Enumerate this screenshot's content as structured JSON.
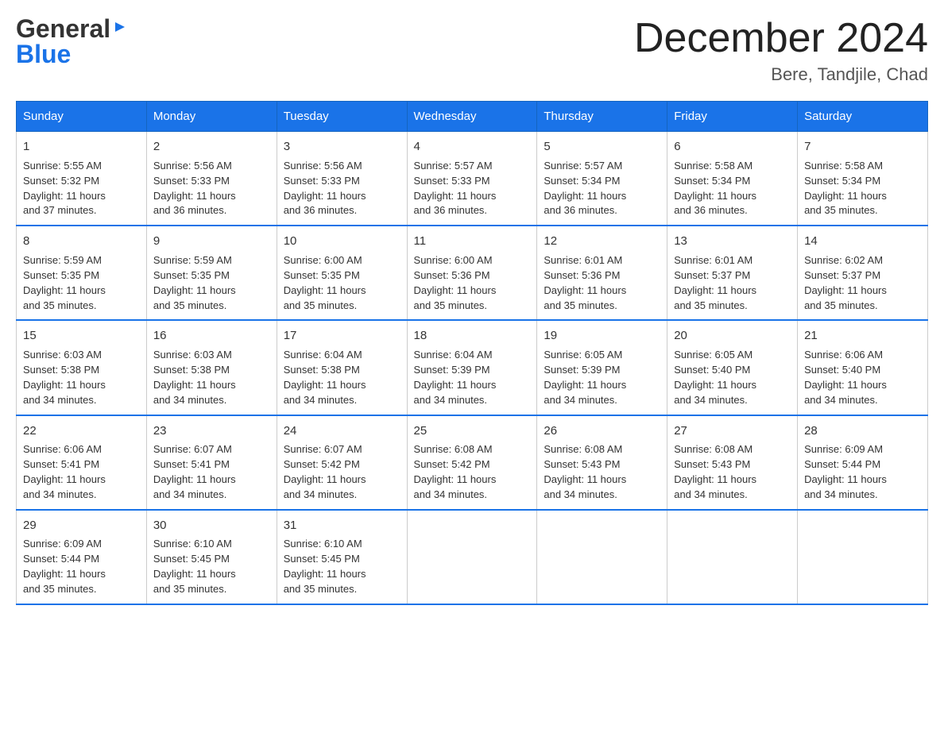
{
  "logo": {
    "line1": "General",
    "triangle": "▶",
    "line2": "Blue"
  },
  "title": {
    "month": "December 2024",
    "location": "Bere, Tandjile, Chad"
  },
  "days_of_week": [
    "Sunday",
    "Monday",
    "Tuesday",
    "Wednesday",
    "Thursday",
    "Friday",
    "Saturday"
  ],
  "weeks": [
    [
      {
        "day": "1",
        "sunrise": "5:55 AM",
        "sunset": "5:32 PM",
        "daylight": "11 hours and 37 minutes."
      },
      {
        "day": "2",
        "sunrise": "5:56 AM",
        "sunset": "5:33 PM",
        "daylight": "11 hours and 36 minutes."
      },
      {
        "day": "3",
        "sunrise": "5:56 AM",
        "sunset": "5:33 PM",
        "daylight": "11 hours and 36 minutes."
      },
      {
        "day": "4",
        "sunrise": "5:57 AM",
        "sunset": "5:33 PM",
        "daylight": "11 hours and 36 minutes."
      },
      {
        "day": "5",
        "sunrise": "5:57 AM",
        "sunset": "5:34 PM",
        "daylight": "11 hours and 36 minutes."
      },
      {
        "day": "6",
        "sunrise": "5:58 AM",
        "sunset": "5:34 PM",
        "daylight": "11 hours and 36 minutes."
      },
      {
        "day": "7",
        "sunrise": "5:58 AM",
        "sunset": "5:34 PM",
        "daylight": "11 hours and 35 minutes."
      }
    ],
    [
      {
        "day": "8",
        "sunrise": "5:59 AM",
        "sunset": "5:35 PM",
        "daylight": "11 hours and 35 minutes."
      },
      {
        "day": "9",
        "sunrise": "5:59 AM",
        "sunset": "5:35 PM",
        "daylight": "11 hours and 35 minutes."
      },
      {
        "day": "10",
        "sunrise": "6:00 AM",
        "sunset": "5:35 PM",
        "daylight": "11 hours and 35 minutes."
      },
      {
        "day": "11",
        "sunrise": "6:00 AM",
        "sunset": "5:36 PM",
        "daylight": "11 hours and 35 minutes."
      },
      {
        "day": "12",
        "sunrise": "6:01 AM",
        "sunset": "5:36 PM",
        "daylight": "11 hours and 35 minutes."
      },
      {
        "day": "13",
        "sunrise": "6:01 AM",
        "sunset": "5:37 PM",
        "daylight": "11 hours and 35 minutes."
      },
      {
        "day": "14",
        "sunrise": "6:02 AM",
        "sunset": "5:37 PM",
        "daylight": "11 hours and 35 minutes."
      }
    ],
    [
      {
        "day": "15",
        "sunrise": "6:03 AM",
        "sunset": "5:38 PM",
        "daylight": "11 hours and 34 minutes."
      },
      {
        "day": "16",
        "sunrise": "6:03 AM",
        "sunset": "5:38 PM",
        "daylight": "11 hours and 34 minutes."
      },
      {
        "day": "17",
        "sunrise": "6:04 AM",
        "sunset": "5:38 PM",
        "daylight": "11 hours and 34 minutes."
      },
      {
        "day": "18",
        "sunrise": "6:04 AM",
        "sunset": "5:39 PM",
        "daylight": "11 hours and 34 minutes."
      },
      {
        "day": "19",
        "sunrise": "6:05 AM",
        "sunset": "5:39 PM",
        "daylight": "11 hours and 34 minutes."
      },
      {
        "day": "20",
        "sunrise": "6:05 AM",
        "sunset": "5:40 PM",
        "daylight": "11 hours and 34 minutes."
      },
      {
        "day": "21",
        "sunrise": "6:06 AM",
        "sunset": "5:40 PM",
        "daylight": "11 hours and 34 minutes."
      }
    ],
    [
      {
        "day": "22",
        "sunrise": "6:06 AM",
        "sunset": "5:41 PM",
        "daylight": "11 hours and 34 minutes."
      },
      {
        "day": "23",
        "sunrise": "6:07 AM",
        "sunset": "5:41 PM",
        "daylight": "11 hours and 34 minutes."
      },
      {
        "day": "24",
        "sunrise": "6:07 AM",
        "sunset": "5:42 PM",
        "daylight": "11 hours and 34 minutes."
      },
      {
        "day": "25",
        "sunrise": "6:08 AM",
        "sunset": "5:42 PM",
        "daylight": "11 hours and 34 minutes."
      },
      {
        "day": "26",
        "sunrise": "6:08 AM",
        "sunset": "5:43 PM",
        "daylight": "11 hours and 34 minutes."
      },
      {
        "day": "27",
        "sunrise": "6:08 AM",
        "sunset": "5:43 PM",
        "daylight": "11 hours and 34 minutes."
      },
      {
        "day": "28",
        "sunrise": "6:09 AM",
        "sunset": "5:44 PM",
        "daylight": "11 hours and 34 minutes."
      }
    ],
    [
      {
        "day": "29",
        "sunrise": "6:09 AM",
        "sunset": "5:44 PM",
        "daylight": "11 hours and 35 minutes."
      },
      {
        "day": "30",
        "sunrise": "6:10 AM",
        "sunset": "5:45 PM",
        "daylight": "11 hours and 35 minutes."
      },
      {
        "day": "31",
        "sunrise": "6:10 AM",
        "sunset": "5:45 PM",
        "daylight": "11 hours and 35 minutes."
      },
      null,
      null,
      null,
      null
    ]
  ],
  "labels": {
    "sunrise": "Sunrise:",
    "sunset": "Sunset:",
    "daylight": "Daylight:"
  }
}
